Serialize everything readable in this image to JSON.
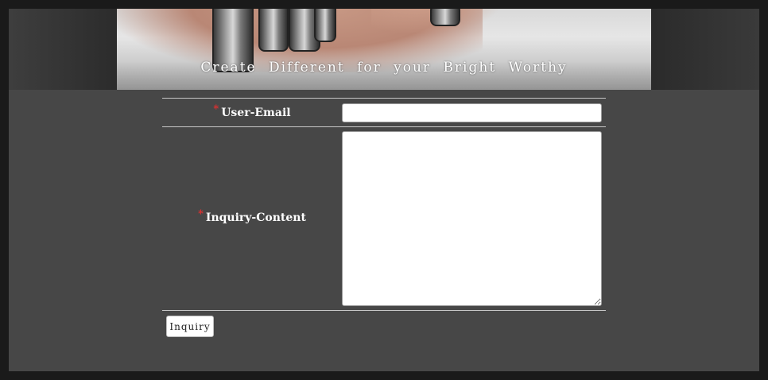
{
  "banner": {
    "slogan": "Create  Different  for  your  Bright  Worthy"
  },
  "form": {
    "required_marker": "*",
    "email": {
      "label": "User-Email",
      "value": "",
      "placeholder": ""
    },
    "content": {
      "label": "Inquiry-Content",
      "value": "",
      "placeholder": ""
    },
    "submit_label": "Inquiry"
  }
}
